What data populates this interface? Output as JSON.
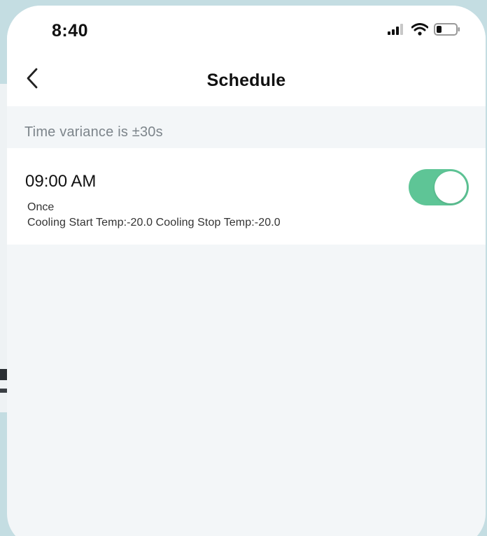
{
  "status_bar": {
    "time": "8:40"
  },
  "nav": {
    "title": "Schedule"
  },
  "info": {
    "variance_text": "Time variance is  ±30s"
  },
  "schedules": [
    {
      "time": "09:00 AM",
      "repeat": "Once",
      "description": "Cooling Start Temp:-20.0 Cooling Stop Temp:-20.0",
      "enabled": true
    }
  ],
  "colors": {
    "toggle_on": "#5ec596",
    "background": "#f3f6f8"
  },
  "icons": {
    "back": "chevron-left-icon",
    "signal": "cellular-signal-icon",
    "wifi": "wifi-icon",
    "battery": "battery-icon"
  }
}
